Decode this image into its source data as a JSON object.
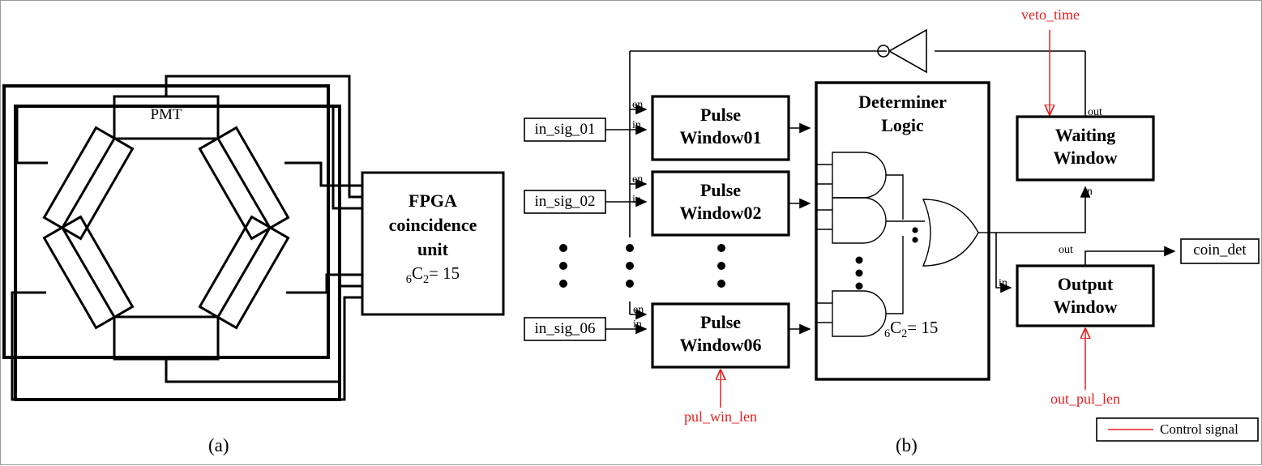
{
  "figure": {
    "panel_a_caption": "(a)",
    "panel_b_caption": "(b)"
  },
  "panel_a": {
    "detector_label": "PMT",
    "fpga": {
      "line1": "FPGA",
      "line2": "coincidence",
      "line3": "unit",
      "formula_pre": "6",
      "formula_c": "C",
      "formula_sub": "2",
      "formula_post": "= 15"
    },
    "num_detectors": 6
  },
  "panel_b": {
    "inputs": [
      {
        "label": "in_sig_01"
      },
      {
        "label": "in_sig_02"
      },
      {
        "label": "in_sig_06"
      }
    ],
    "pulse_windows": [
      {
        "line1": "Pulse",
        "line2": "Window01",
        "pin_en": "en",
        "pin_in": "in"
      },
      {
        "line1": "Pulse",
        "line2": "Window02",
        "pin_en": "en",
        "pin_in": "in"
      },
      {
        "line1": "Pulse",
        "line2": "Window06",
        "pin_en": "en",
        "pin_in": "in"
      }
    ],
    "determiner": {
      "line1": "Determiner",
      "line2": "Logic",
      "formula_pre": "6",
      "formula_c": "C",
      "formula_sub": "2",
      "formula_post": "= 15",
      "and_gate_count_shown": 3,
      "or_gate_count_shown": 1
    },
    "waiting_window": {
      "line1": "Waiting",
      "line2": "Window",
      "pin_in": "in",
      "pin_out": "out"
    },
    "output_window": {
      "line1": "Output",
      "line2": "Window",
      "pin_in": "in",
      "pin_out": "out"
    },
    "coin_det": {
      "label": "coin_det"
    },
    "control_signals": [
      {
        "name": "veto_time"
      },
      {
        "name": "pul_win_len"
      },
      {
        "name": "out_pul_len"
      }
    ],
    "legend": {
      "text": "Control signal"
    }
  },
  "colors": {
    "line": "#000000",
    "control": "#e41f1f",
    "background": "#ffffff"
  }
}
